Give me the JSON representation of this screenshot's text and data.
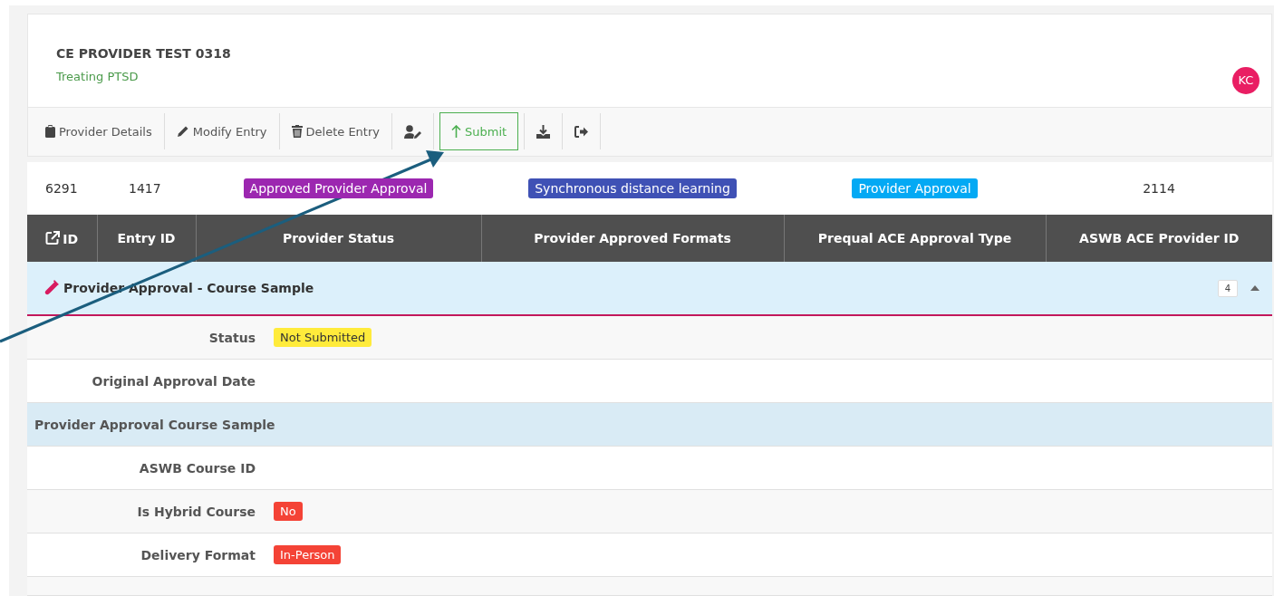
{
  "header": {
    "title": "CE PROVIDER TEST 0318",
    "subtitle": "Treating PTSD",
    "avatar": "KC"
  },
  "toolbar": [
    {
      "label": "Provider Details",
      "kind": "plain"
    },
    {
      "label": "Modify Entry",
      "kind": "plain"
    },
    {
      "label": "Delete Entry",
      "kind": "plain"
    },
    {
      "kind": "plain"
    },
    {
      "label": "Submit",
      "kind": "outlined"
    },
    {
      "kind": "plain"
    },
    {
      "kind": "plain"
    }
  ],
  "summary": [
    {
      "text": "6291",
      "kind": "text"
    },
    {
      "text": "1417",
      "kind": "text"
    },
    {
      "text": "Approved Provider Approval",
      "kind": "badge",
      "color": "#9c27b0"
    },
    {
      "text": "Synchronous distance learning",
      "kind": "badge",
      "color": "#3f51b5"
    },
    {
      "text": "Provider Approval",
      "kind": "badge",
      "color": "#03a9f4"
    },
    {
      "text": "2114",
      "kind": "text"
    }
  ],
  "table": {
    "columns": [
      "ID",
      "Entry ID",
      "Provider Status",
      "Provider Approved Formats",
      "Prequal ACE Approval Type",
      "ASWB ACE Provider ID"
    ]
  },
  "group": {
    "title": "Provider Approval - Course Sample",
    "count": "4",
    "expanded": true
  },
  "details": [
    {
      "kind": "field",
      "label": "Status",
      "value": "Not Submitted",
      "color": "#ffeb3b"
    },
    {
      "kind": "field",
      "label": "Original Approval Date"
    },
    {
      "kind": "section",
      "label": "Provider Approval Course Sample"
    },
    {
      "kind": "field",
      "label": "ASWB Course ID"
    },
    {
      "kind": "field",
      "label": "Is Hybrid Course",
      "value": "No",
      "color": "#f44336"
    },
    {
      "kind": "field",
      "label": "Delivery Format",
      "value": "In-Person",
      "color": "#f44336"
    }
  ]
}
